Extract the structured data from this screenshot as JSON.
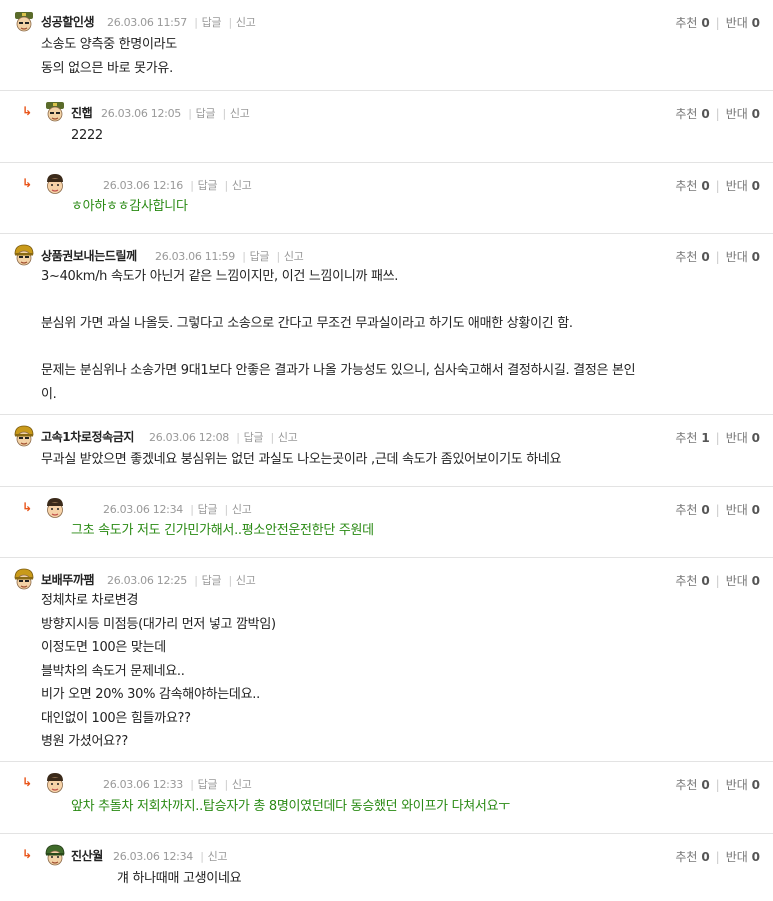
{
  "vote": {
    "up_label": "추천",
    "down_label": "반대"
  },
  "actions": {
    "reply": "답글",
    "report": "신고"
  },
  "comments": [
    {
      "nick": "성공할인생",
      "time": "26.03.06 11:57",
      "text": "소송도 양측중 한명이라도\n동의 없으믄 바로 못가유.",
      "up": "0",
      "down": "0"
    },
    {
      "nick": "진햅",
      "time": "26.03.06 12:05",
      "text": "2222",
      "up": "0",
      "down": "0"
    },
    {
      "nick": "",
      "time": "26.03.06 12:16",
      "text": "ㅎ아하ㅎㅎ감사합니다",
      "up": "0",
      "down": "0"
    },
    {
      "nick": "상품권보내는드릴께",
      "time": "26.03.06 11:59",
      "text": "3~40km/h 속도가 아닌거 같은 느낌이지만, 이건 느낌이니까 패쓰.\n\n분심위 가면 과실 나올듯. 그렇다고 소송으로 간다고 무조건 무과실이라고 하기도 애매한 상황이긴 함.\n\n문제는 분심위나 소송가면 9대1보다 안좋은 결과가 나올 가능성도 있으니, 심사숙고해서 결정하시길. 결정은 본인\n이.",
      "up": "0",
      "down": "0"
    },
    {
      "nick": "고속1차로정속금지",
      "time": "26.03.06 12:08",
      "text": "무과실 받았으면 좋겠네요 붕심위는 없던 과실도 나오는곳이라 ,근데 속도가 좀있어보이기도 하네요",
      "up": "1",
      "down": "0"
    },
    {
      "nick": "",
      "time": "26.03.06 12:34",
      "text": "그초 속도가 저도 긴가민가해서..평소안전운전한단 주원데",
      "up": "0",
      "down": "0"
    },
    {
      "nick": "보배뚜까팸",
      "time": "26.03.06 12:25",
      "text": "정체차로 차로변경\n방향지시등 미점등(대가리 먼저 넣고 깜박임)\n이정도면 100은 맞는데\n블박차의 속도거 문제네요..\n비가 오면 20% 30% 감속해야하는데요..\n대인없이 100은 힘들까요??\n병원 가셨어요??",
      "up": "0",
      "down": "0"
    },
    {
      "nick": "",
      "time": "26.03.06 12:33",
      "text": "앞차 추돌차 저회차까지..탑승자가 총 8명이였던데다 동승했던 와이프가 다쳐서요ㅜ",
      "up": "0",
      "down": "0"
    },
    {
      "nick": "진산월",
      "time": "26.03.06 12:34",
      "text": "걔 하나때매 고생이네요",
      "up": "0",
      "down": "0"
    }
  ]
}
